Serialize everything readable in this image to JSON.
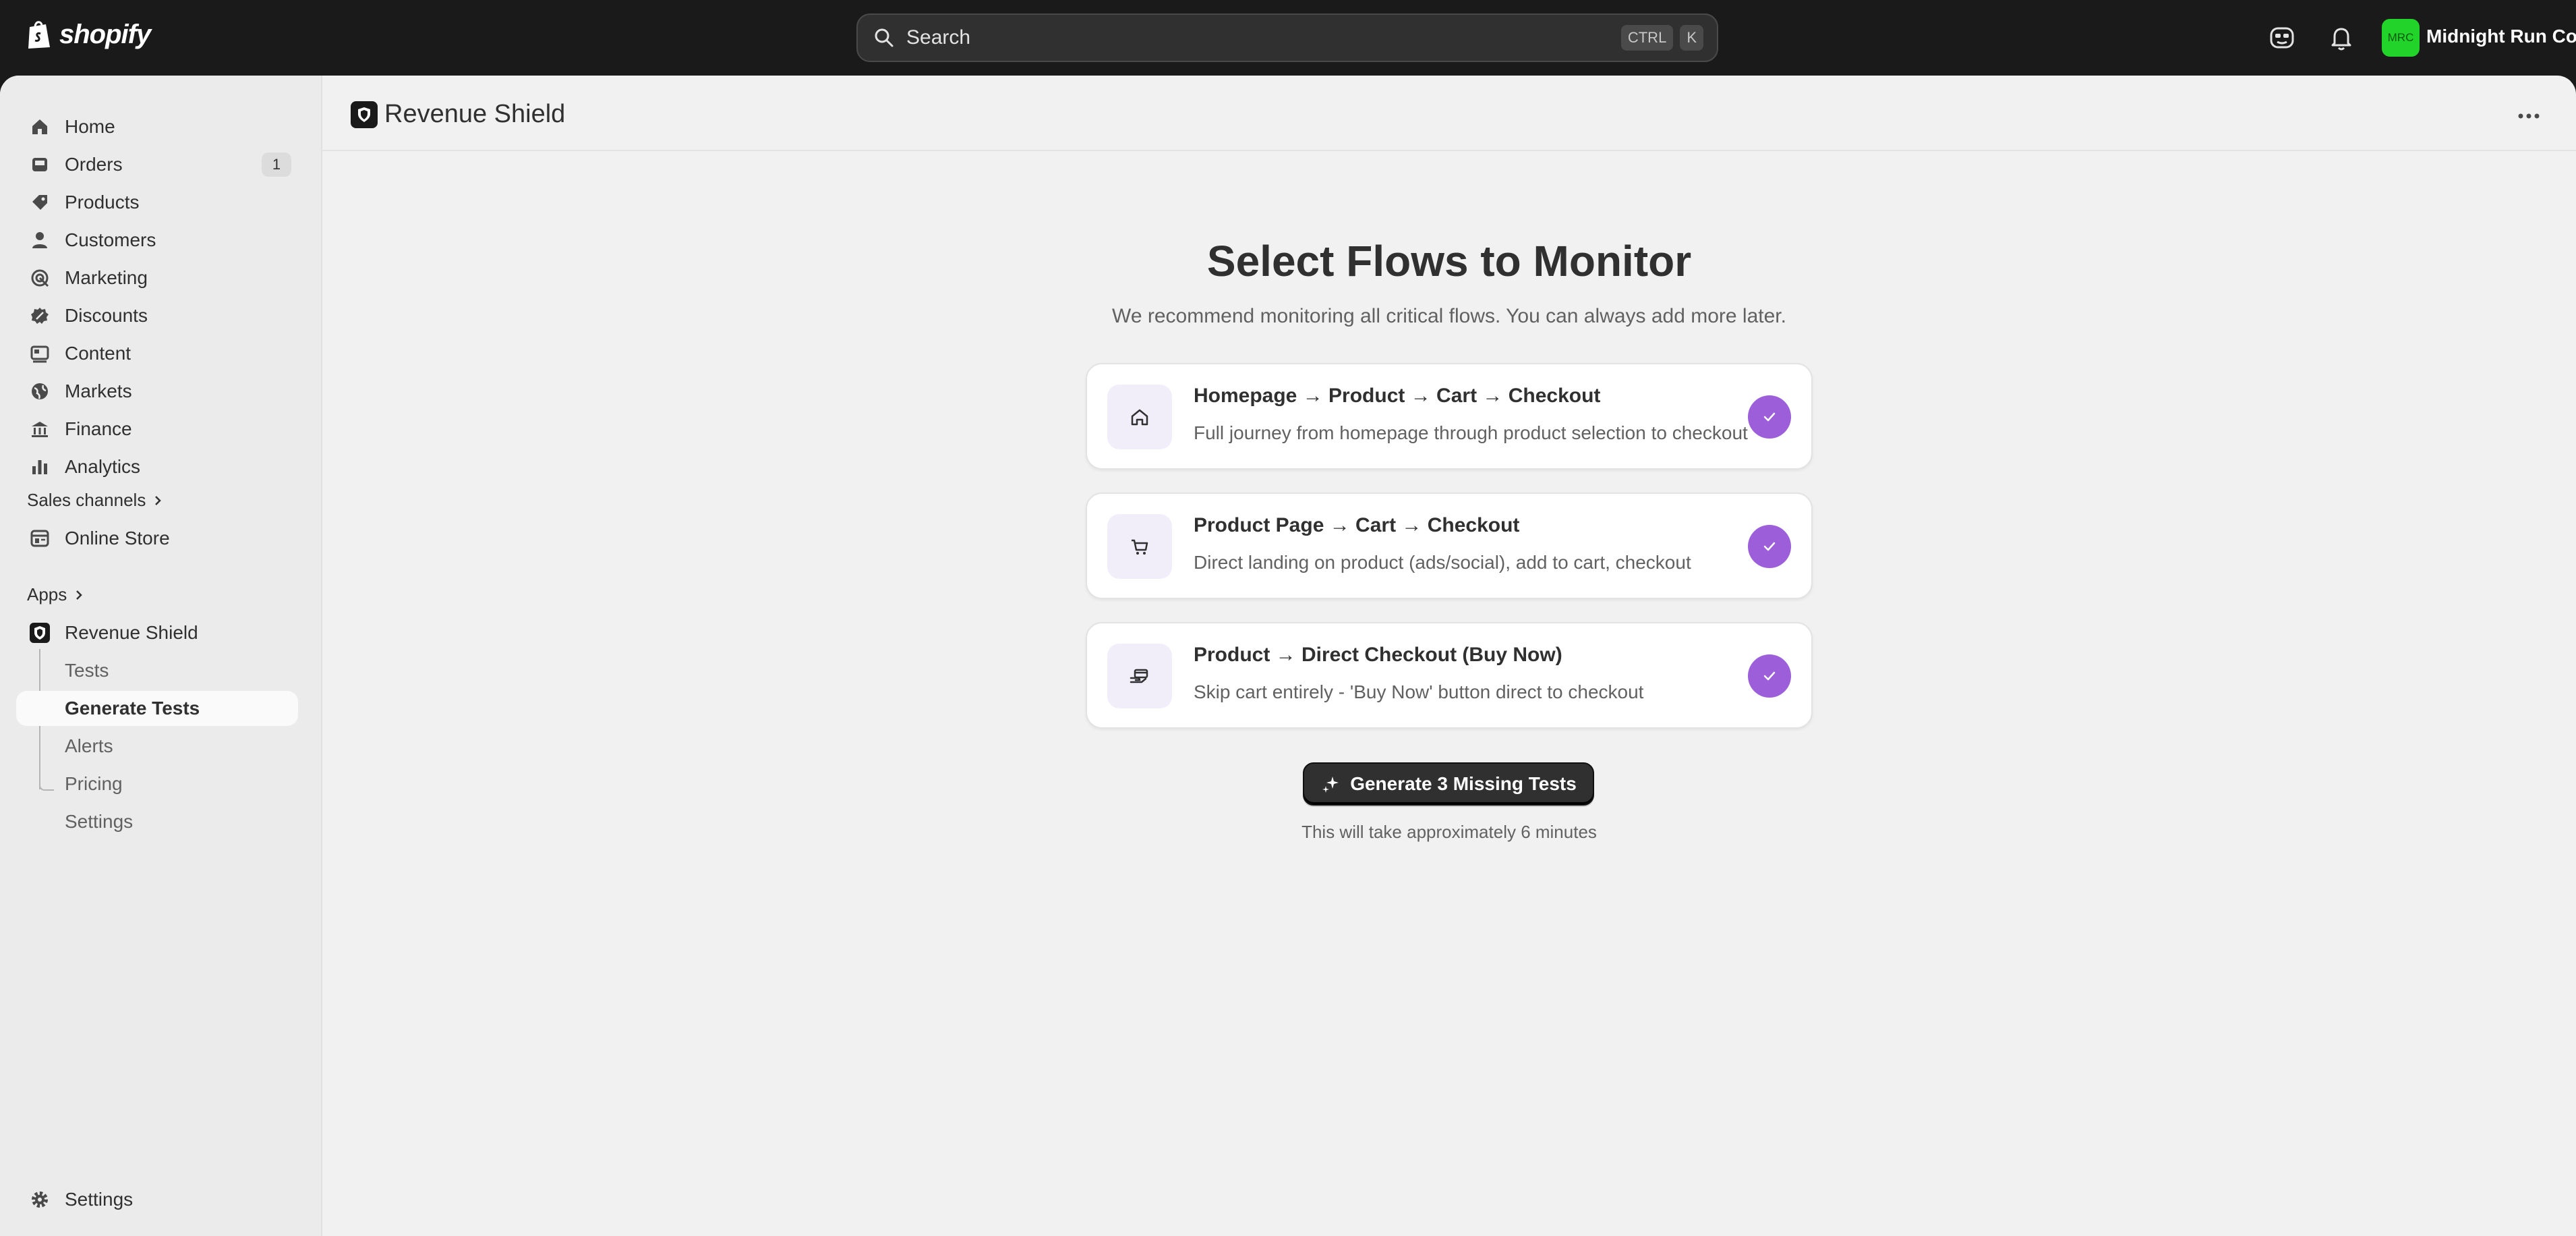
{
  "topbar": {
    "brand": "shopify",
    "search_placeholder": "Search",
    "shortcut_keys": [
      "CTRL",
      "K"
    ],
    "store_initials": "MRC",
    "store_name": "Midnight Run Co"
  },
  "sidebar": {
    "main_items": [
      {
        "label": "Home",
        "icon": "home-icon"
      },
      {
        "label": "Orders",
        "icon": "orders-icon",
        "badge": "1"
      },
      {
        "label": "Products",
        "icon": "tag-icon"
      },
      {
        "label": "Customers",
        "icon": "person-icon"
      },
      {
        "label": "Marketing",
        "icon": "target-icon"
      },
      {
        "label": "Discounts",
        "icon": "discount-icon"
      },
      {
        "label": "Content",
        "icon": "content-icon"
      },
      {
        "label": "Markets",
        "icon": "globe-icon"
      },
      {
        "label": "Finance",
        "icon": "bank-icon"
      },
      {
        "label": "Analytics",
        "icon": "chart-icon"
      }
    ],
    "sales_channels_title": "Sales channels",
    "online_store_label": "Online Store",
    "apps_title": "Apps",
    "app_name": "Revenue Shield",
    "app_subitems": [
      "Tests",
      "Generate Tests",
      "Alerts",
      "Pricing",
      "Settings"
    ],
    "active_subitem": "Generate Tests",
    "settings_label": "Settings"
  },
  "page": {
    "title": "Revenue Shield",
    "heading": "Select Flows to Monitor",
    "subheading": "We recommend monitoring all critical flows. You can always add more later.",
    "flows": [
      {
        "title": "Homepage → Product → Cart → Checkout",
        "description": "Full journey from homepage through product selection to checkout",
        "icon": "home-icon",
        "checked": true
      },
      {
        "title": "Product Page → Cart → Checkout",
        "description": "Direct landing on product (ads/social), add to cart, checkout",
        "icon": "cart-icon",
        "checked": true
      },
      {
        "title": "Product → Direct Checkout (Buy Now)",
        "description": "Skip cart entirely - 'Buy Now' button direct to checkout",
        "icon": "hand-card-icon",
        "checked": true
      }
    ],
    "generate_button": "Generate 3 Missing Tests",
    "helper_text": "This will take approximately 6 minutes"
  },
  "colors": {
    "accent": "#9c5fd9",
    "topbar_bg": "#1a1a1a",
    "store_badge": "#22d42a"
  }
}
